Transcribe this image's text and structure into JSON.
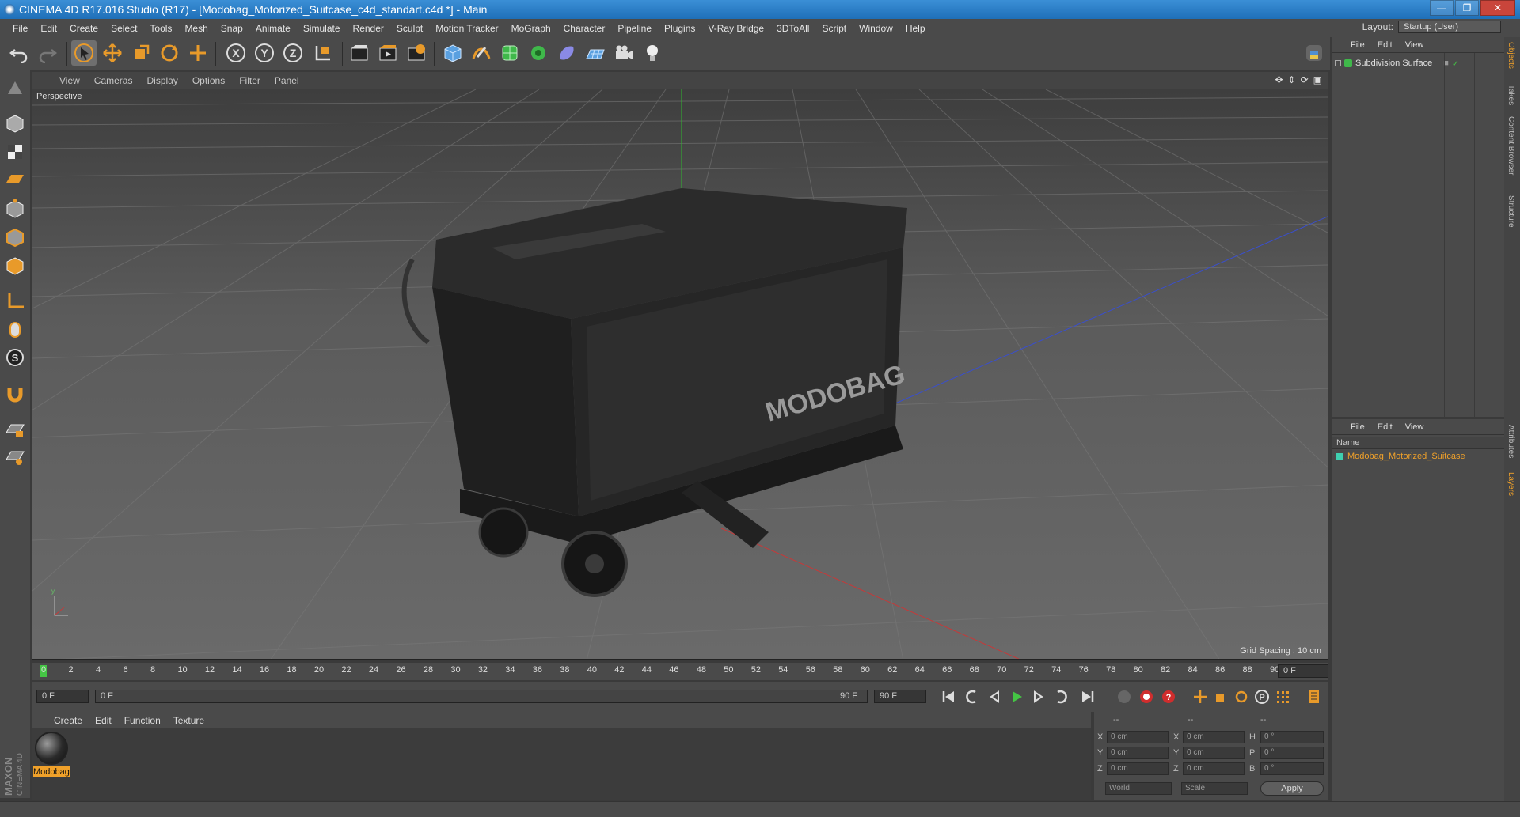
{
  "window": {
    "title": "CINEMA 4D R17.016 Studio (R17) - [Modobag_Motorized_Suitcase_c4d_standart.c4d *] - Main"
  },
  "menubar": {
    "items": [
      "File",
      "Edit",
      "Create",
      "Select",
      "Tools",
      "Mesh",
      "Snap",
      "Animate",
      "Simulate",
      "Render",
      "Sculpt",
      "Motion Tracker",
      "MoGraph",
      "Character",
      "Pipeline",
      "Plugins",
      "V-Ray Bridge",
      "3DToAll",
      "Script",
      "Window",
      "Help"
    ]
  },
  "layout": {
    "label": "Layout:",
    "value": "Startup (User)"
  },
  "viewport": {
    "menu": [
      "View",
      "Cameras",
      "Display",
      "Options",
      "Filter",
      "Panel"
    ],
    "label": "Perspective",
    "grid_spacing": "Grid Spacing : 10 cm"
  },
  "timeline": {
    "ticks": [
      "0",
      "2",
      "4",
      "6",
      "8",
      "10",
      "12",
      "14",
      "16",
      "18",
      "20",
      "22",
      "24",
      "26",
      "28",
      "30",
      "32",
      "34",
      "36",
      "38",
      "40",
      "42",
      "44",
      "46",
      "48",
      "50",
      "52",
      "54",
      "56",
      "58",
      "60",
      "62",
      "64",
      "66",
      "68",
      "70",
      "72",
      "74",
      "76",
      "78",
      "80",
      "82",
      "84",
      "86",
      "88",
      "90"
    ],
    "current_frame": "0 F",
    "end_frame_field": "0 F"
  },
  "transport": {
    "start": "0 F",
    "range_start": "0 F",
    "range_end": "90 F",
    "end": "90 F"
  },
  "material_manager": {
    "menu": [
      "Create",
      "Edit",
      "Function",
      "Texture"
    ],
    "material_name": "Modobag"
  },
  "coordinates": {
    "headers": [
      "--",
      "--",
      "--"
    ],
    "rows": [
      {
        "axis": "X",
        "pos": "0 cm",
        "axis2": "X",
        "size": "0 cm",
        "rot_label": "H",
        "rot": "0 °"
      },
      {
        "axis": "Y",
        "pos": "0 cm",
        "axis2": "Y",
        "size": "0 cm",
        "rot_label": "P",
        "rot": "0 °"
      },
      {
        "axis": "Z",
        "pos": "0 cm",
        "axis2": "Z",
        "size": "0 cm",
        "rot_label": "B",
        "rot": "0 °"
      }
    ],
    "mode1": "World",
    "mode2": "Scale",
    "apply": "Apply"
  },
  "object_manager": {
    "menu": [
      "File",
      "Edit",
      "View"
    ],
    "object": "Subdivision Surface"
  },
  "layer_manager": {
    "menu": [
      "File",
      "Edit",
      "View"
    ],
    "column_name": "Name",
    "layer": "Modobag_Motorized_Suitcase"
  },
  "side_tabs": [
    "Objects",
    "Takes",
    "Content Browser",
    "Structure",
    "Attributes",
    "Layers"
  ],
  "branding": {
    "line1": "MAXON",
    "line2": "CINEMA 4D"
  },
  "colors": {
    "accent": "#f0a12a",
    "active_green": "#44c544",
    "title_blue": "#2b7fc8"
  }
}
